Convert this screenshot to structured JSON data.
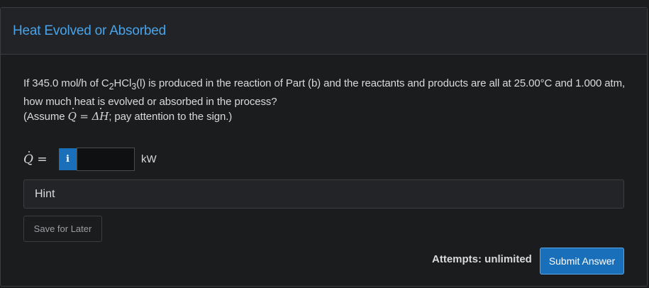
{
  "card": {
    "title": "Heat Evolved or Absorbed"
  },
  "question": {
    "part1": "If 345.0 mol/h of C",
    "sub1": "2",
    "part2": "HCl",
    "sub2": "3",
    "part3": "(l) is produced in the reaction of Part (b) and the reactants and products are all at 25.00°C and 1.000 atm, how much heat is evolved or absorbed in the process?",
    "assume_open": "(Assume ",
    "q_symbol": "Q",
    "equals": " = ",
    "delta_h": "ΔH",
    "assume_close": "; pay attention to the sign.)"
  },
  "answer": {
    "label_symbol": "Q",
    "label_equals": " =",
    "info_label": "i",
    "value": "",
    "placeholder": "",
    "unit": "kW"
  },
  "hint": {
    "label": "Hint"
  },
  "actions": {
    "save_label": "Save for Later",
    "attempts_text": "Attempts: unlimited",
    "submit_label": "Submit Answer"
  },
  "colors": {
    "accent": "#1a6fba",
    "title": "#4aa3e8",
    "background": "#1b1c1e"
  }
}
